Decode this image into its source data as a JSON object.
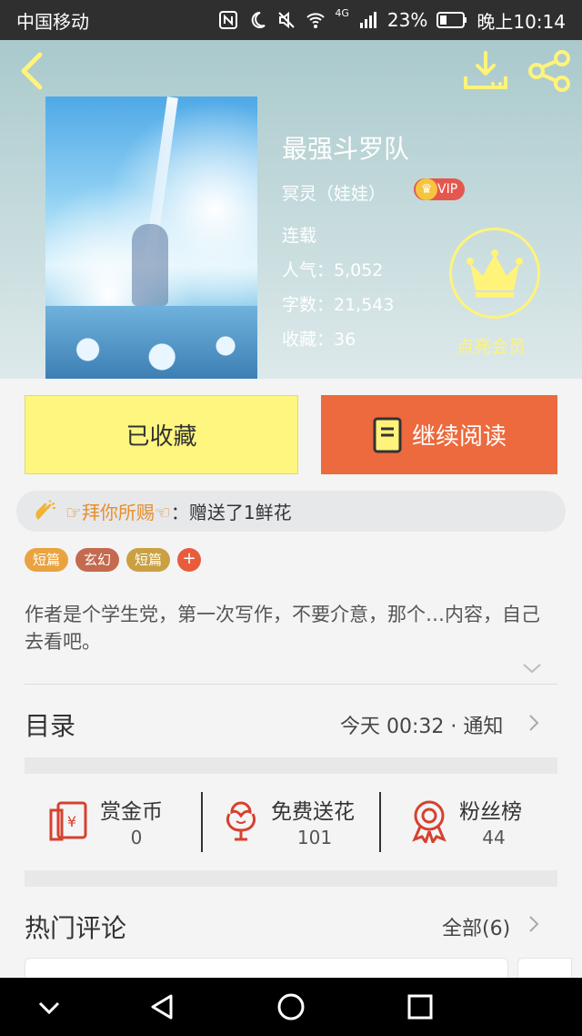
{
  "status_bar": {
    "carrier": "中国移动",
    "battery": "23%",
    "time": "晚上10:14",
    "net_label": "4G"
  },
  "book": {
    "title": "最强斗罗队",
    "author": "冥灵（娃娃）",
    "vip_badge": "VIP",
    "status": "连载",
    "popularity": "人气：5,052",
    "word_count": "字数：21,543",
    "favorites": "收藏：36",
    "vip_promo": "点亮会员"
  },
  "actions": {
    "collected_label": "已收藏",
    "continue_label": "继续阅读"
  },
  "gift": {
    "user": "☞拜你所赐☜",
    "text": "：赠送了1鲜花"
  },
  "tags": [
    {
      "label": "短篇",
      "color": "#e9a33f"
    },
    {
      "label": "玄幻",
      "color": "#c46a4f"
    },
    {
      "label": "短篇",
      "color": "#caa042"
    }
  ],
  "tag_add": "+",
  "description": "作者是个学生党，第一次写作，不要介意，那个…内容，自己去看吧。",
  "toc": {
    "title": "目录",
    "update": "今天 00:32 · 通知"
  },
  "features": [
    {
      "label": "赏金币",
      "count": "0",
      "icon": "red-envelope-icon"
    },
    {
      "label": "免费送花",
      "count": "101",
      "icon": "flower-icon"
    },
    {
      "label": "粉丝榜",
      "count": "44",
      "icon": "medal-icon"
    }
  ],
  "comments": {
    "title": "热门评论",
    "all_label": "全部(6)"
  },
  "colors": {
    "accent_orange": "#ec6a3d",
    "accent_yellow": "#fef67e",
    "vip_gold": "#fff37a",
    "icon_red": "#d6412f"
  }
}
